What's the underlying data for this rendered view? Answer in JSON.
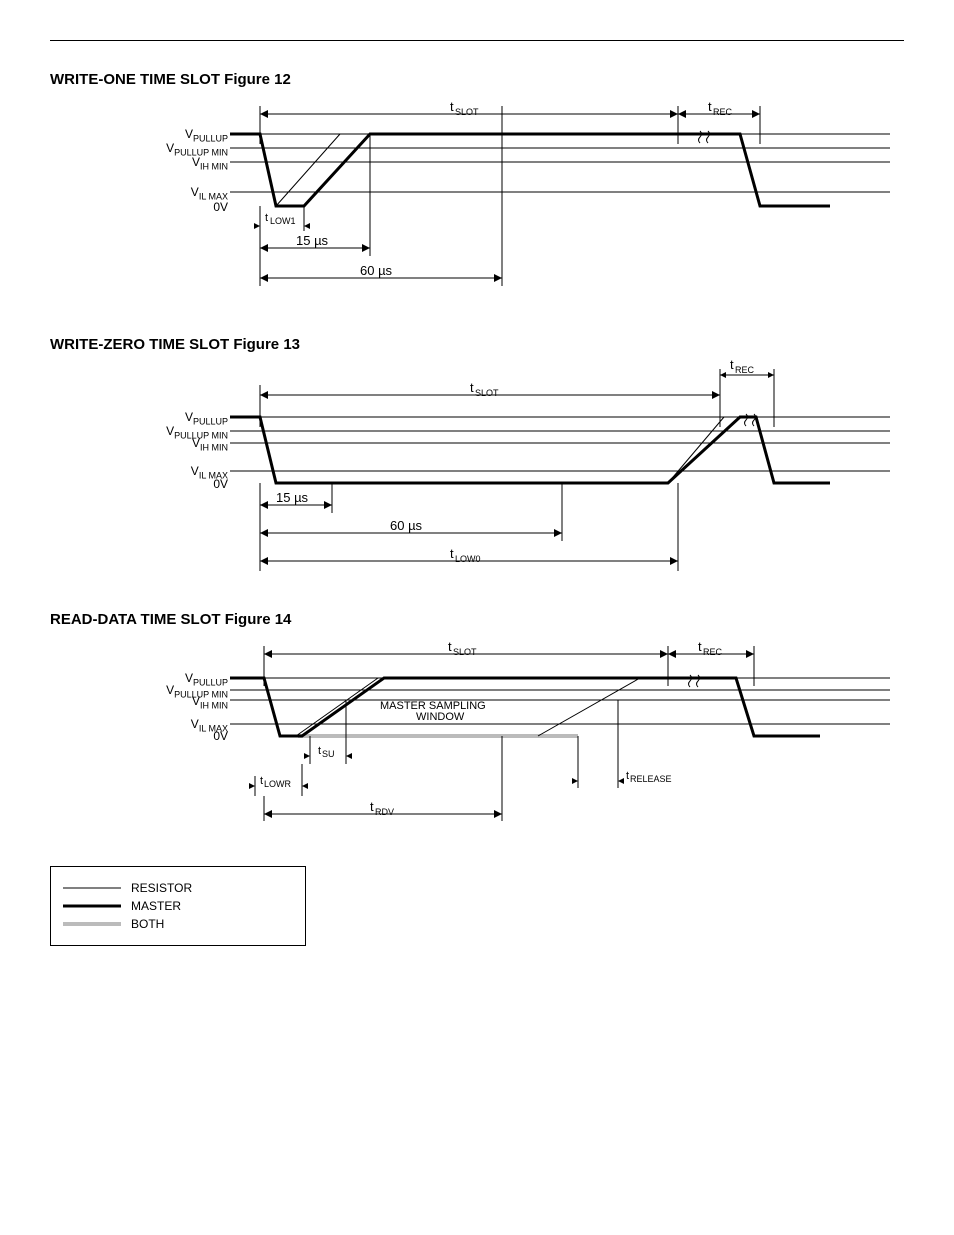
{
  "figures": {
    "write1": {
      "title": "WRITE-ONE TIME SLOT Figure 12",
      "ylabels": [
        "V_PULLUP",
        "V_PULLUP MIN",
        "V_IH MIN",
        "V_IL MAX",
        "0V"
      ],
      "tSlot": "t_SLOT",
      "tRec": "t_REC",
      "tLow1": "t_LOW1",
      "t15": "15 µs",
      "t60": "60 µs"
    },
    "write0": {
      "title": "WRITE-ZERO TIME SLOT Figure 13",
      "ylabels": [
        "V_PULLUP",
        "V_PULLUP MIN",
        "V_IH MIN",
        "V_IL MAX",
        "0V"
      ],
      "tSlot": "t_SLOT",
      "tRec": "t_REC",
      "tLow0": "t_LOW0",
      "t15": "15 µs",
      "t60": "60 µs"
    },
    "read": {
      "title": "READ-DATA TIME SLOT Figure 14",
      "ylabels": [
        "V_PULLUP",
        "V_PULLUP MIN",
        "V_IH MIN",
        "V_IL MAX",
        "0V"
      ],
      "tSlot": "t_SLOT",
      "tRec": "t_REC",
      "tSu": "t_SU",
      "tLowR": "t_LOWR",
      "tRdv": "t_RDV",
      "tRelease": "t_RELEASE",
      "sampling": "MASTER SAMPLING\nWINDOW"
    }
  },
  "legend": {
    "resistor": "RESISTOR",
    "master": "MASTER",
    "both": "BOTH"
  }
}
